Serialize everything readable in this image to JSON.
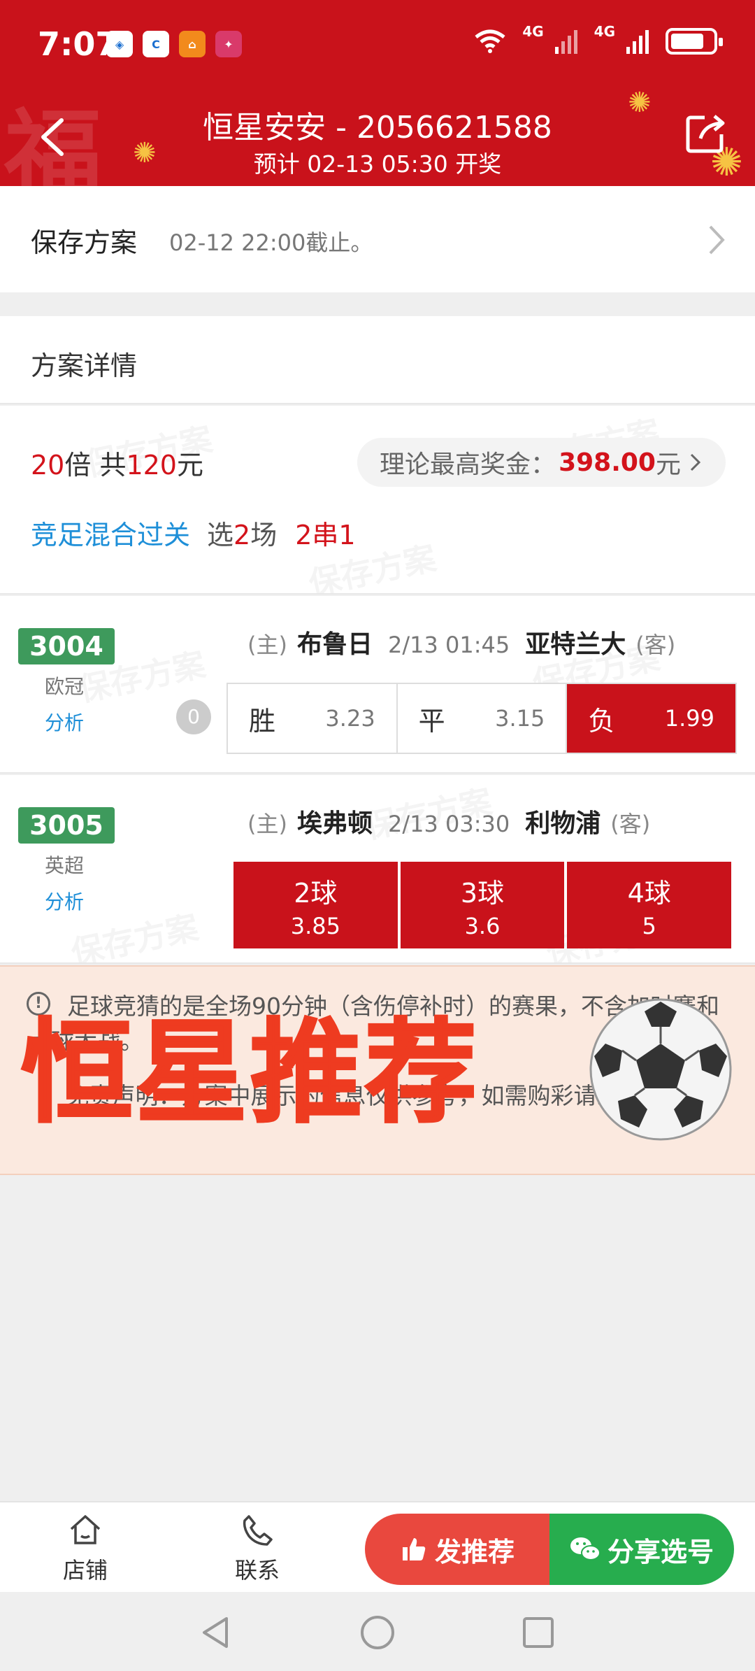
{
  "status_bar": {
    "time": "7:07",
    "network1": "4G",
    "network2": "4G",
    "app_icons": [
      "app-1",
      "app-2",
      "app-3",
      "app-4"
    ]
  },
  "header": {
    "title": "恒星安安 - 2056621588",
    "subtitle": "预计 02-13 05:30 开奖"
  },
  "save_plan": {
    "title": "保存方案",
    "deadline": "02-12 22:00截止。"
  },
  "detail": {
    "section_title": "方案详情",
    "multiplier": "20",
    "multiplier_unit": "倍 共",
    "total": "120",
    "currency": "元",
    "max_prize_label": "理论最高奖金：",
    "max_prize_value": "398.00",
    "max_prize_unit": "元",
    "play_type": "竞足混合过关",
    "select_prefix": "选",
    "select_count": "2",
    "select_suffix": "场",
    "serial": "2串1",
    "watermark": "保存方案"
  },
  "matches": [
    {
      "code": "3004",
      "league": "欧冠",
      "analysis": "分析",
      "badge": "0",
      "home_tag": "(主)",
      "home": "布鲁日",
      "time": "2/13 01:45",
      "away": "亚特兰大",
      "away_tag": "(客)",
      "options": [
        {
          "label": "胜",
          "odds": "3.23",
          "selected": false
        },
        {
          "label": "平",
          "odds": "3.15",
          "selected": false
        },
        {
          "label": "负",
          "odds": "1.99",
          "selected": true
        }
      ]
    },
    {
      "code": "3005",
      "league": "英超",
      "analysis": "分析",
      "home_tag": "(主)",
      "home": "埃弗顿",
      "time": "2/13 03:30",
      "away": "利物浦",
      "away_tag": "(客)",
      "options": [
        {
          "label": "2球",
          "odds": "3.85",
          "selected": true
        },
        {
          "label": "3球",
          "odds": "3.6",
          "selected": true
        },
        {
          "label": "4球",
          "odds": "5",
          "selected": true
        }
      ]
    }
  ],
  "notice": {
    "text1": "足球竞猜的是全场90分钟（含伤停补时）的赛果，不含加时赛和点球大战。",
    "text2": "免责声明：方案中展示的信息仅供参考，如需购彩请到实体站",
    "overlay": "恒星推荐"
  },
  "bottom_bar": {
    "shop": "店铺",
    "contact": "联系",
    "recommend": "发推荐",
    "share_pick": "分享选号"
  },
  "colors": {
    "brand_red": "#c9121b",
    "green": "#3e9a5c",
    "share_green": "#27ad4e",
    "link_blue": "#1e8fd8"
  }
}
